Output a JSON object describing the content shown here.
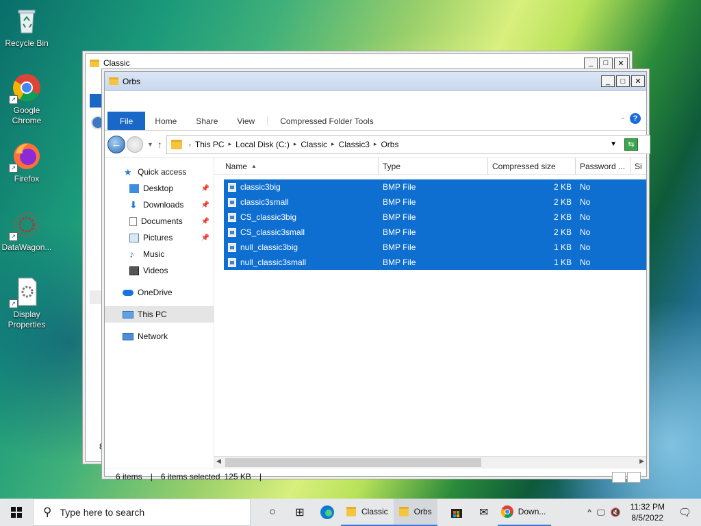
{
  "desktop": {
    "icons": [
      {
        "label": "Recycle Bin",
        "icon": "recycle-bin-icon"
      },
      {
        "label": "Google Chrome",
        "icon": "chrome-icon"
      },
      {
        "label": "Firefox",
        "icon": "firefox-icon"
      },
      {
        "label": "DataWagon...",
        "icon": "datawagon-icon"
      },
      {
        "label": "Display Properties",
        "icon": "display-properties-icon"
      }
    ]
  },
  "back_window": {
    "title": "Classic",
    "status_partial": "8"
  },
  "window": {
    "title": "Orbs",
    "controls": {
      "minimize": "_",
      "maximize": "□",
      "close": "✕"
    },
    "ribbon": {
      "tabs": [
        "File",
        "Home",
        "Share",
        "View",
        "Compressed Folder Tools"
      ],
      "help": "?"
    },
    "address": {
      "crumbs": [
        "This PC",
        "Local Disk (C:)",
        "Classic",
        "Classic3",
        "Orbs"
      ]
    },
    "nav_pane": {
      "items": [
        {
          "label": "Quick access",
          "icon": "star-icon",
          "pinned": false
        },
        {
          "label": "Desktop",
          "icon": "desktop-folder-icon",
          "pinned": true
        },
        {
          "label": "Downloads",
          "icon": "downloads-icon",
          "pinned": true
        },
        {
          "label": "Documents",
          "icon": "documents-icon",
          "pinned": true
        },
        {
          "label": "Pictures",
          "icon": "pictures-icon",
          "pinned": true
        },
        {
          "label": "Music",
          "icon": "music-icon",
          "pinned": false
        },
        {
          "label": "Videos",
          "icon": "videos-icon",
          "pinned": false
        },
        {
          "label": "OneDrive",
          "icon": "onedrive-icon",
          "pinned": false
        },
        {
          "label": "This PC",
          "icon": "this-pc-icon",
          "pinned": false,
          "selected": true
        },
        {
          "label": "Network",
          "icon": "network-icon",
          "pinned": false
        }
      ]
    },
    "columns": [
      "Name",
      "Type",
      "Compressed size",
      "Password ...",
      "Si"
    ],
    "files": [
      {
        "name": "classic3big",
        "type": "BMP File",
        "size": "2 KB",
        "password": "No"
      },
      {
        "name": "classic3small",
        "type": "BMP File",
        "size": "2 KB",
        "password": "No"
      },
      {
        "name": "CS_classic3big",
        "type": "BMP File",
        "size": "2 KB",
        "password": "No"
      },
      {
        "name": "CS_classic3small",
        "type": "BMP File",
        "size": "2 KB",
        "password": "No"
      },
      {
        "name": "null_classic3big",
        "type": "BMP File",
        "size": "1 KB",
        "password": "No"
      },
      {
        "name": "null_classic3small",
        "type": "BMP File",
        "size": "1 KB",
        "password": "No"
      }
    ],
    "status": {
      "count": "6 items",
      "selected": "6 items selected",
      "size": "125 KB",
      "sep": "|"
    }
  },
  "taskbar": {
    "search_placeholder": "Type here to search",
    "apps": [
      {
        "label": "Classic",
        "icon": "folder-icon"
      },
      {
        "label": "Orbs",
        "icon": "folder-icon"
      },
      {
        "label": "Down...",
        "icon": "chrome-icon"
      }
    ],
    "time": "11:32 PM",
    "date": "8/5/2022"
  },
  "colors": {
    "selection": "#0f6fd1",
    "file_tab": "#1968c7",
    "titlebar": "#dbe6f5"
  }
}
